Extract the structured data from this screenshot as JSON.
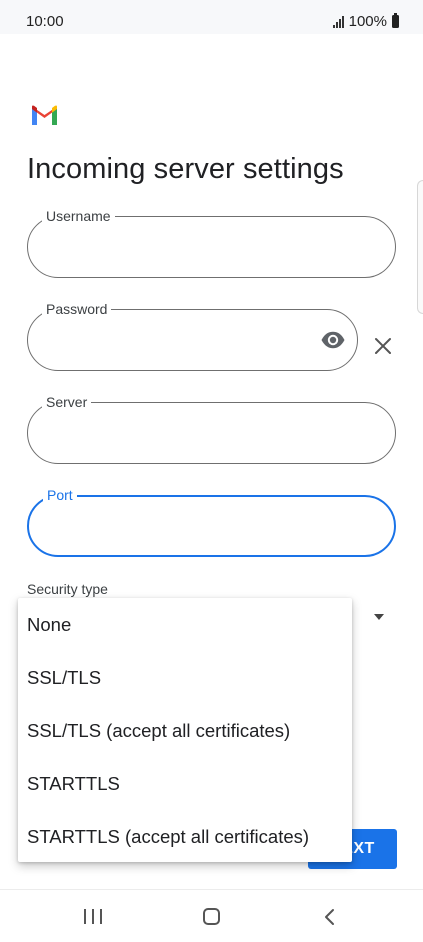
{
  "status_bar": {
    "time": "10:00",
    "battery_text": "100%"
  },
  "app": {
    "logo_icon": "gmail-logo-icon",
    "colors": {
      "accent": "#1a73e8",
      "gmail_red": "#ea4335",
      "gmail_blue": "#4285f4",
      "gmail_green": "#34a853",
      "gmail_yellow": "#fbbc04"
    }
  },
  "page": {
    "title": "Incoming server settings"
  },
  "form": {
    "username": {
      "label": "Username",
      "value": ""
    },
    "password": {
      "label": "Password",
      "value": "",
      "reveal_icon": "eye-icon",
      "clear_icon": "close-icon"
    },
    "server": {
      "label": "Server",
      "value": ""
    },
    "port": {
      "label": "Port",
      "value": "",
      "focused": true
    },
    "security_type": {
      "label": "Security type",
      "selected": ""
    }
  },
  "dropdown": {
    "options": [
      "None",
      "SSL/TLS",
      "SSL/TLS (accept all certificates)",
      "STARTTLS",
      "STARTTLS (accept all certificates)"
    ]
  },
  "actions": {
    "next_label": "NEXT"
  },
  "nav_bar": {
    "recents_icon": "recents-icon",
    "home_icon": "home-icon",
    "back_icon": "back-icon"
  }
}
